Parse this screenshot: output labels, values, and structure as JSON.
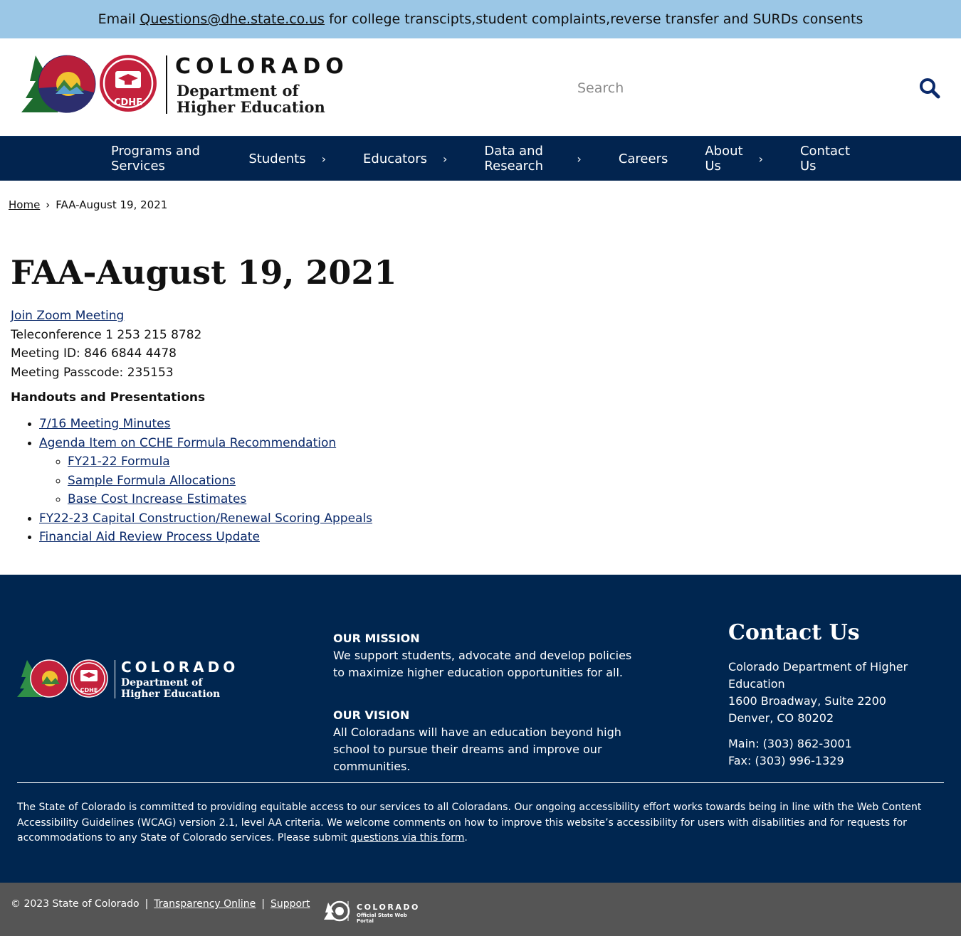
{
  "alert": {
    "prefix": "Email",
    "email": "Questions@dhe.state.co.us",
    "suffix": "for college transcipts,student complaints,reverse transfer and SURDs consents"
  },
  "header": {
    "logo_title": "COLORADO",
    "logo_subtitle_line1": "Department of",
    "logo_subtitle_line2": "Higher Education",
    "logo_badge": "CDHE",
    "search_placeholder": "Search"
  },
  "nav": {
    "items": [
      {
        "label": "Programs and Services",
        "has_submenu": false
      },
      {
        "label": "Students",
        "has_submenu": true
      },
      {
        "label": "Educators",
        "has_submenu": true
      },
      {
        "label": "Data and Research",
        "has_submenu": true
      },
      {
        "label": "Careers",
        "has_submenu": false
      },
      {
        "label": "About Us",
        "has_submenu": true
      },
      {
        "label": "Contact Us",
        "has_submenu": false
      }
    ]
  },
  "breadcrumb": {
    "home": "Home",
    "separator": "›",
    "current": "FAA-August 19, 2021"
  },
  "main": {
    "title": "FAA-August 19, 2021",
    "zoom_link": "Join Zoom Meeting",
    "teleconference": "Teleconference 1 253 215 8782",
    "meeting_id": "Meeting ID: 846 6844 4478",
    "passcode": "Meeting Passcode: 235153",
    "handouts_heading": "Handouts and Presentations",
    "handouts": [
      {
        "label": "7/16 Meeting Minutes"
      },
      {
        "label": "Agenda Item on CCHE Formula Recommendation"
      },
      {
        "label": "FY21-22 Formula"
      },
      {
        "label": "Sample Formula Allocations"
      },
      {
        "label": "Base Cost Increase Estimates"
      },
      {
        "label": "FY22-23 Capital Construction/Renewal Scoring Appeals"
      },
      {
        "label": "Financial Aid Review Process Update"
      }
    ]
  },
  "footer": {
    "logo_title": "COLORADO",
    "logo_subtitle_line1": "Department of",
    "logo_subtitle_line2": "Higher Education",
    "logo_badge": "CDHE",
    "mission_heading": "OUR MISSION",
    "mission_text": "We support students, advocate and develop policies to maximize higher education opportunities for all.",
    "vision_heading": "OUR VISION",
    "vision_text": "All Coloradans will have an education beyond high school to pursue their dreams and improve our communities.",
    "contact_heading": "Contact Us",
    "contact_org": "Colorado Department of Higher Education",
    "contact_street": "1600 Broadway, Suite 2200",
    "contact_city": "Denver, CO 80202",
    "contact_main": "Main: (303) 862-3001",
    "contact_fax": "Fax: (303) 996-1329",
    "a11y_text": "The State of Colorado is committed to providing equitable access to our services to all Coloradans. Our ongoing accessibility effort works towards being in line with the Web Content Accessibility Guidelines (WCAG) version 2.1, level AA criteria. We welcome comments on how to improve this website’s accessibility for users with disabilities and for requests for accommodations to any State of Colorado services. Please submit",
    "a11y_link": "questions via this form",
    "a11y_end": "."
  },
  "bottom": {
    "copyright": "© 2023 State of Colorado",
    "separator": "|",
    "transparency": "Transparency Online",
    "support": "Support",
    "portal_title": "COLORADO",
    "portal_subtitle": "Official State Web Portal"
  },
  "colors": {
    "alert_bg": "#9bc7e6",
    "nav_bg": "#02244f",
    "footer_bg": "#002650",
    "bottom_bg": "#555555",
    "link": "#0b2a6b"
  }
}
